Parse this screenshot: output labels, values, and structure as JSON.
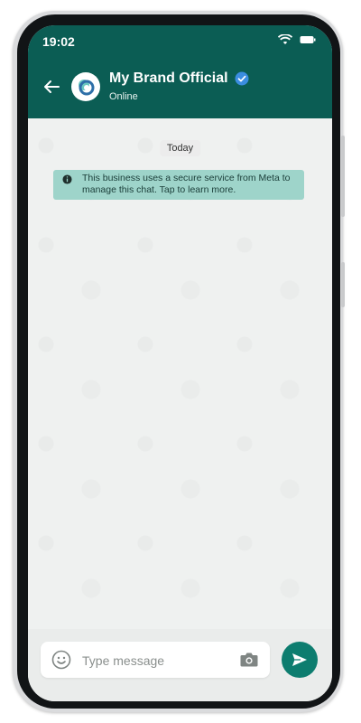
{
  "status_bar": {
    "time": "19:02"
  },
  "header": {
    "contact_name": "My Brand Official",
    "presence": "Online",
    "verified": true,
    "colors": {
      "header_bg": "#0b5d54",
      "accent": "#0d7d6f"
    },
    "icons": {
      "back": "back-arrow-icon",
      "avatar": "brand-logo-icon",
      "verified": "verified-badge-icon"
    }
  },
  "chat": {
    "date_chip": "Today",
    "system_notice": "This business uses a secure service from Meta to manage this chat. Tap to learn more.",
    "notice_icon": "info-icon"
  },
  "composer": {
    "placeholder": "Type message",
    "icons": {
      "emoji": "emoji-icon",
      "camera": "camera-icon",
      "send": "send-icon"
    }
  }
}
